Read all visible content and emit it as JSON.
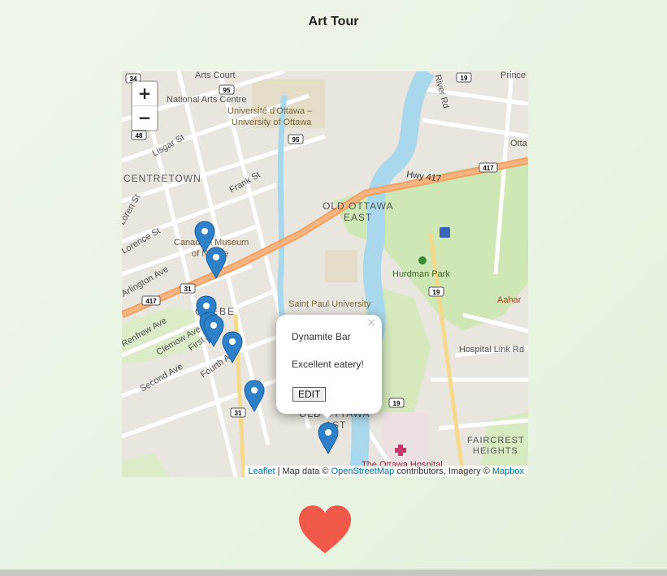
{
  "page": {
    "title": "Art Tour"
  },
  "map": {
    "zoom_in": "+",
    "zoom_out": "−",
    "labels": {
      "arts_court": "Arts Court",
      "national_arts_centre": "National Arts Centre",
      "uottawa": "Université d'Ottawa –",
      "uottawa2": "University of Ottawa",
      "centretown": "CENTRETOWN",
      "lisgar": "Lisgar St",
      "frank": "Frank St",
      "lorenst": "Loren St",
      "lorence": "Lorence St",
      "hwy417": "Hwy 417",
      "old_ottawa_east": "OLD OTTAWA",
      "east": "EAST",
      "canadian_museum": "Canadian Museum",
      "of_nature": "of Nature",
      "arlington": "Arlington Ave",
      "glebe": "GLEBE",
      "saint_paul": "Saint Paul University",
      "hurdman_park": "Hurdman Park",
      "aahar": "Aahar",
      "hospital_link": "Hospital Link Rd",
      "fairfield": "Renfrew Ave",
      "clemow": "Clemow Ave",
      "first_ave": "First Ave",
      "fourth_ave": "Fourth Ave",
      "second_ave": "Second Ave",
      "faircrest": "FAIRCREST",
      "heights": "HEIGHTS",
      "ottawa_hospital": "The Ottawa Hospital",
      "river_rd": "River Rd",
      "prince": "Prince",
      "otta": "Otta",
      "old_ottawa_south": "OLD OTTAWA",
      "south": "AST"
    },
    "shields": [
      "34",
      "95",
      "48",
      "95",
      "19",
      "417",
      "417",
      "31",
      "19",
      "19",
      "31"
    ],
    "popup": {
      "close": "×",
      "name": "Dynamite Bar",
      "description": "Excellent eatery!",
      "edit_label": "EDIT"
    },
    "attribution": {
      "leaflet": "Leaflet",
      "map_data": " | Map data © ",
      "osm": "OpenStreetMap",
      "contrib": " contributors, Imagery © ",
      "mapbox": "Mapbox"
    },
    "marker_count": 8,
    "colors": {
      "marker": "#2e81c8",
      "highway": "#f69c58",
      "river": "#95d3ea",
      "park": "#cbe6b2",
      "heart": "#f15a4a"
    }
  }
}
